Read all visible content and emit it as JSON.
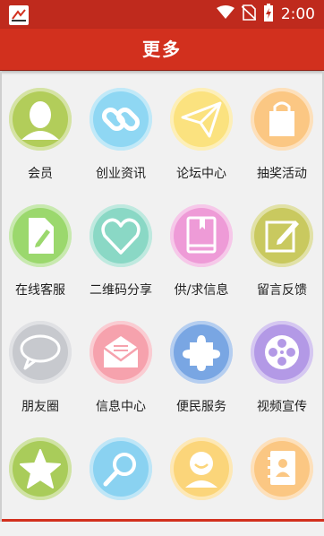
{
  "status_bar": {
    "time": "2:00",
    "icons": [
      "wifi-icon",
      "no-sim-icon",
      "battery-icon"
    ]
  },
  "header": {
    "title": "更多"
  },
  "colors": {
    "accent": "#d2301e",
    "statusbar": "#bf2a1d"
  },
  "tiles": [
    {
      "label": "会员",
      "icon": "user-icon",
      "color": "#b2cd5a"
    },
    {
      "label": "创业资讯",
      "icon": "link-icon",
      "color": "#8fd7f3"
    },
    {
      "label": "论坛中心",
      "icon": "paper-plane-icon",
      "color": "#fbe27f"
    },
    {
      "label": "抽奖活动",
      "icon": "shopping-bag-icon",
      "color": "#fbc783"
    },
    {
      "label": "在线客服",
      "icon": "document-edit-icon",
      "color": "#9bd86d"
    },
    {
      "label": "二维码分享",
      "icon": "heart-icon",
      "color": "#8ad8c5"
    },
    {
      "label": "供/求信息",
      "icon": "book-icon",
      "color": "#ee9bd7"
    },
    {
      "label": "留言反馈",
      "icon": "note-edit-icon",
      "color": "#c9c95f"
    },
    {
      "label": "朋友圈",
      "icon": "speech-bubble-icon",
      "color": "#c7c9ce"
    },
    {
      "label": "信息中心",
      "icon": "envelope-icon",
      "color": "#f6a2ad"
    },
    {
      "label": "便民服务",
      "icon": "puzzle-icon",
      "color": "#79a6e3"
    },
    {
      "label": "视频宣传",
      "icon": "film-reel-icon",
      "color": "#b399e6"
    },
    {
      "label": "",
      "icon": "star-icon",
      "color": "#a9cc5a"
    },
    {
      "label": "",
      "icon": "magnifier-icon",
      "color": "#8ad2f1"
    },
    {
      "label": "",
      "icon": "smiley-icon",
      "color": "#fbd57a"
    },
    {
      "label": "",
      "icon": "contacts-book-icon",
      "color": "#fbc783"
    }
  ]
}
